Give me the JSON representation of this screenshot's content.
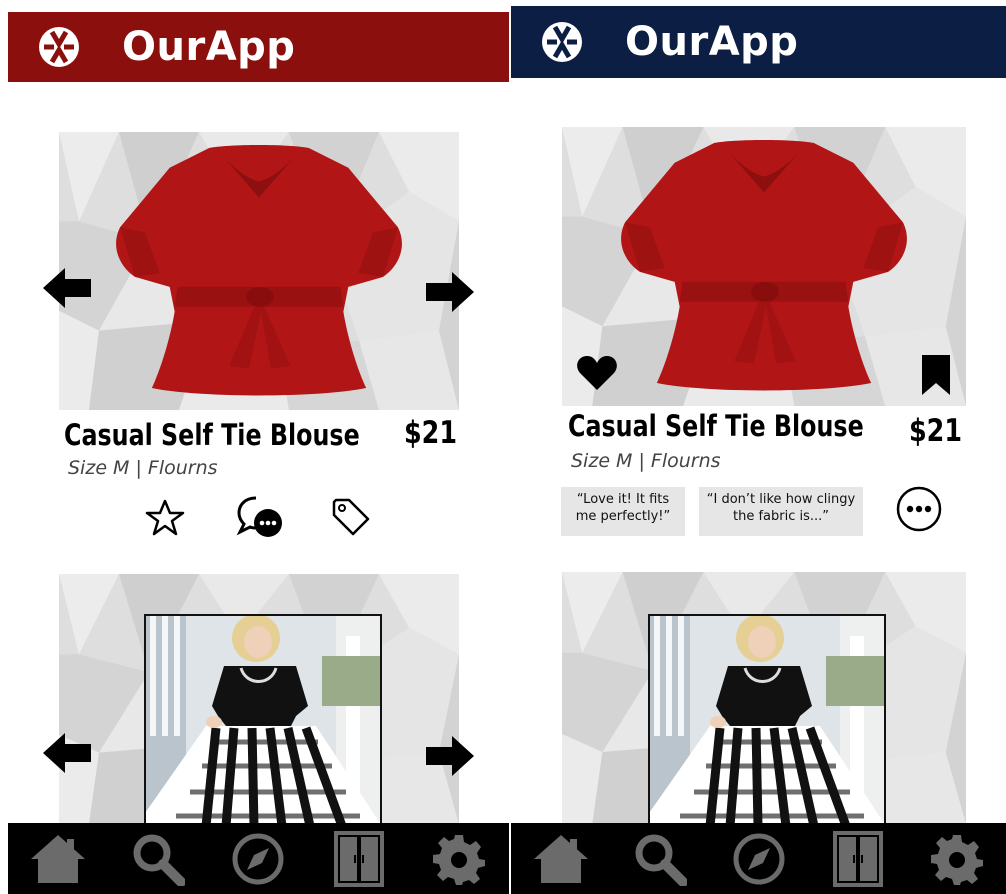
{
  "app": {
    "title": "OurApp",
    "logo_icon": "app-logo-icon"
  },
  "colors": {
    "left_header": "#8b0f0c",
    "right_header": "#0d1e44",
    "nav_bg": "#000000",
    "nav_icon": "#6b6b6b",
    "blouse": "#b01414"
  },
  "product": {
    "name": "Casual Self Tie Blouse",
    "price": "$21",
    "size_brand": "Size M | Flourns"
  },
  "left_panel": {
    "actions": [
      "star-icon",
      "comment-icon",
      "tag-icon"
    ]
  },
  "right_panel": {
    "reviews": [
      "“Love it! It fits me perfectly!”",
      "“I don’t like how clingy the fabric is...”"
    ],
    "more_icon": "more-options-icon",
    "overlay_icons": [
      "heart-icon",
      "bookmark-icon"
    ]
  },
  "nav": [
    "home-icon",
    "search-icon",
    "compass-icon",
    "wardrobe-icon",
    "settings-icon"
  ]
}
